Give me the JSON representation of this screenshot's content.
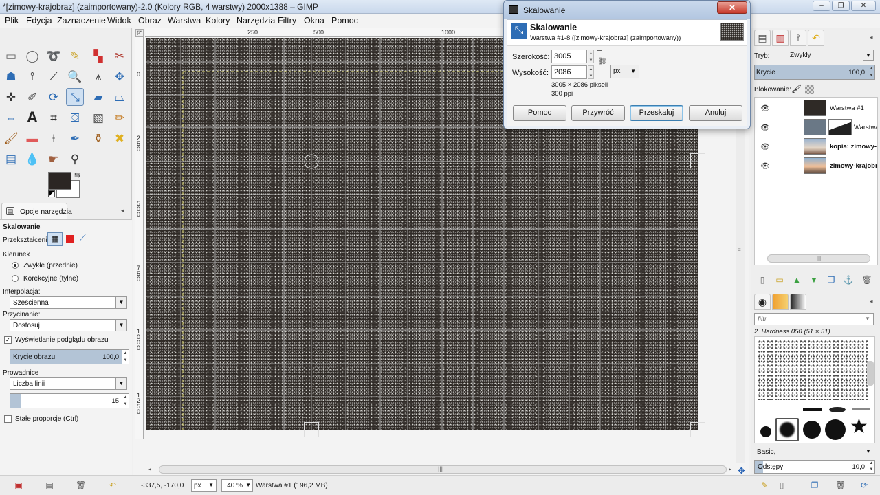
{
  "window": {
    "title": "*[zimowy-krajobraz] (zaimportowany)-2.0 (Kolory RGB, 4 warstwy) 2000x1388 – GIMP"
  },
  "menubar": [
    "Plik",
    "Edycja",
    "Zaznaczenie",
    "Widok",
    "Obraz",
    "Warstwa",
    "Kolory",
    "Narzędzia",
    "Filtry",
    "Okna",
    "Pomoc"
  ],
  "rulers": {
    "h_ticks": [
      "250",
      "500",
      "1000"
    ],
    "v_ticks": [
      "0",
      "2 5 0",
      "5 0 0",
      "7 5 0",
      "1 0 0 0",
      "1 2 5 0"
    ]
  },
  "toolbox": {
    "tools": [
      "rect-select",
      "ellipse-select",
      "free-select",
      "fuzzy-select",
      "color-select",
      "scissors",
      "foreground-select",
      "paths",
      "color-picker",
      "zoom",
      "measure",
      "move",
      "align",
      "crop",
      "rotate",
      "scale",
      "shear",
      "perspective",
      "flip",
      "text",
      "cage",
      "bucket-fill",
      "blend",
      "pencil",
      "paintbrush",
      "eraser",
      "airbrush",
      "ink",
      "clone",
      "heal",
      "perspective-clone",
      "blur",
      "smudge",
      "dodge-burn"
    ],
    "fg_color": "#2b2623",
    "bg_color": "#ffffff"
  },
  "tool_options": {
    "tab_label": "Opcje narzędzia",
    "title": "Skalowanie",
    "transform_label": "Przekształcenie:",
    "direction_label": "Kierunek",
    "direction_normal": "Zwykłe (przednie)",
    "direction_corrective": "Korekcyjne (tylne)",
    "interpolation_label": "Interpolacja:",
    "interpolation_value": "Sześcienna",
    "clipping_label": "Przycinanie:",
    "clipping_value": "Dostosuj",
    "preview_label": "Wyświetlanie podglądu obrazu",
    "opacity_label": "Krycie obrazu",
    "opacity_value": "100,0",
    "guides_label": "Prowadnice",
    "guides_value": "Liczba linii",
    "lines_value": "15",
    "keep_aspect_label": "Stałe proporcje  (Ctrl)"
  },
  "statusbar": {
    "coords": "-337,5, -170,0",
    "unit": "px",
    "zoom": "40 %",
    "info": "Warstwa #1 (196,2 MB)"
  },
  "layers_panel": {
    "mode_label": "Tryb:",
    "mode_value": "Zwykły",
    "opacity_label": "Krycie",
    "opacity_value": "100,0",
    "lock_label": "Blokowanie:",
    "layers": [
      {
        "name": "Warstwa #1"
      },
      {
        "name": "Warstwa"
      },
      {
        "name": "kopia: zimowy-k"
      },
      {
        "name": "zimowy-krajobr"
      }
    ]
  },
  "brushes_panel": {
    "filter_placeholder": "filtr",
    "brush_name": "2. Hardness 050 (51 × 51)",
    "preset": "Basic,",
    "spacing_label": "Odstępy",
    "spacing_value": "10,0"
  },
  "dialog": {
    "window_title": "Skalowanie",
    "title": "Skalowanie",
    "subtitle": "Warstwa #1-8 ([zimowy-krajobraz] (zaimportowany))",
    "width_label": "Szerokość:",
    "width_value": "3005",
    "height_label": "Wysokość:",
    "height_value": "2086",
    "unit": "px",
    "size_info": "3005 × 2086 pikseli",
    "resolution": "300 ppi",
    "buttons": {
      "help": "Pomoc",
      "reset": "Przywróć",
      "scale": "Przeskaluj",
      "cancel": "Anuluj"
    }
  },
  "colors": {
    "image_bg": "#2f2a26",
    "accent": "#3c7fb1",
    "close_red": "#c7392a"
  }
}
